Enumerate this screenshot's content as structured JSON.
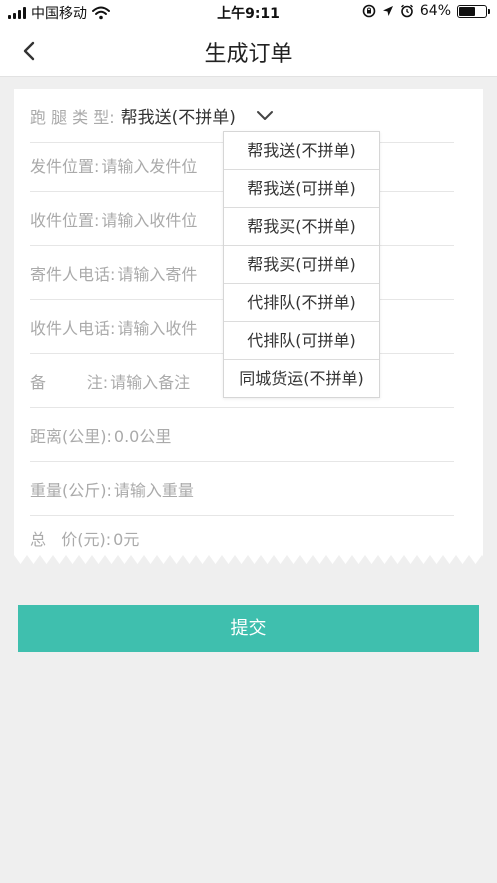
{
  "status_bar": {
    "carrier": "中国移动",
    "time": "上午9:11",
    "battery_percent": "64%",
    "battery_level": 0.64
  },
  "nav": {
    "title": "生成订单"
  },
  "form": {
    "rows": [
      {
        "label": "跑 腿 类 型:",
        "value": "帮我送(不拼单)"
      },
      {
        "label": "发件位置:",
        "value": "请输入发件位"
      },
      {
        "label": "收件位置:",
        "value": "请输入收件位"
      },
      {
        "label": "寄件人电话:",
        "value": "请输入寄件"
      },
      {
        "label": "收件人电话:",
        "value": "请输入收件"
      },
      {
        "label": "备        注:",
        "value": "请输入备注"
      },
      {
        "label": "距离(公里):",
        "value": "0.0公里"
      },
      {
        "label": "重量(公斤):",
        "value": "请输入重量"
      },
      {
        "label": "总   价(元):",
        "value": "0元"
      }
    ]
  },
  "dropdown": {
    "options": [
      "帮我送(不拼单)",
      "帮我送(可拼单)",
      "帮我买(不拼单)",
      "帮我买(可拼单)",
      "代排队(不拼单)",
      "代排队(可拼单)",
      "同城货运(不拼单)"
    ]
  },
  "submit_label": "提交",
  "colors": {
    "accent": "#3fbfae",
    "background": "#efefef"
  }
}
